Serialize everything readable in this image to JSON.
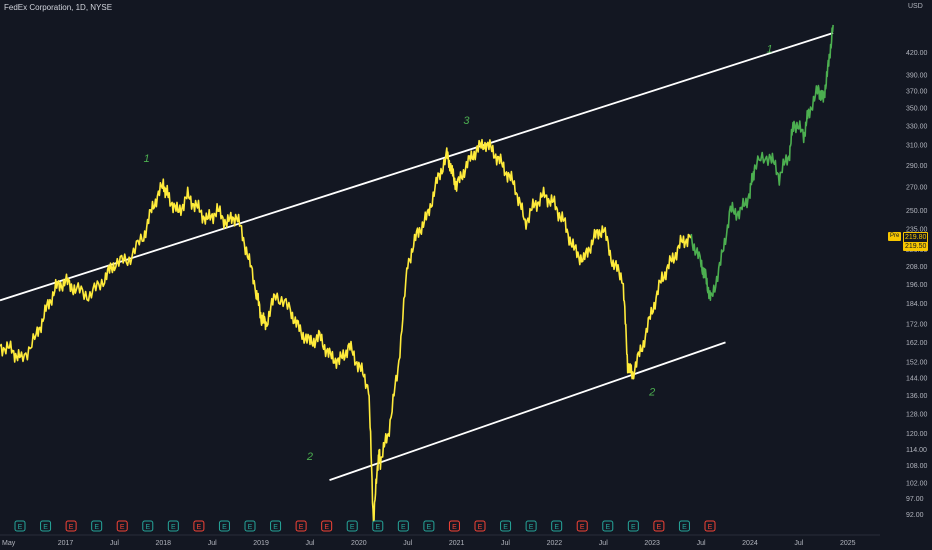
{
  "header": {
    "title": "FedEx Corporation, 1D, NYSE",
    "currency": "USD"
  },
  "price_tags": {
    "pre_label": "Pre",
    "pre_value": "219.80",
    "last_value": "219.50"
  },
  "colors": {
    "background": "#131722",
    "price_line": "#ffeb3b",
    "projection_line": "#4caf50",
    "channel_line": "#ffffff",
    "wave_label": "#4caf50",
    "accent": "#f7c600"
  },
  "chart_data": {
    "type": "line",
    "title": "FedEx Corporation, 1D, NYSE",
    "y_scale": "log",
    "ylim": [
      88,
      480
    ],
    "xlim": [
      2016.33,
      2025.33
    ],
    "grid": false,
    "y_ticks": [
      "92.00",
      "97.00",
      "102.00",
      "108.00",
      "114.00",
      "120.00",
      "128.00",
      "136.00",
      "144.00",
      "152.00",
      "162.00",
      "172.00",
      "184.00",
      "196.00",
      "208.00",
      "220.00",
      "235.00",
      "250.00",
      "270.00",
      "290.00",
      "310.00",
      "330.00",
      "350.00",
      "370.00",
      "390.00",
      "420.00"
    ],
    "x_ticks": [
      {
        "label": "May",
        "x": 2016.33
      },
      {
        "label": "2017",
        "x": 2017.0
      },
      {
        "label": "Jul",
        "x": 2017.5
      },
      {
        "label": "2018",
        "x": 2018.0
      },
      {
        "label": "Jul",
        "x": 2018.5
      },
      {
        "label": "2019",
        "x": 2019.0
      },
      {
        "label": "Jul",
        "x": 2019.5
      },
      {
        "label": "2020",
        "x": 2020.0
      },
      {
        "label": "Jul",
        "x": 2020.5
      },
      {
        "label": "2021",
        "x": 2021.0
      },
      {
        "label": "Jul",
        "x": 2021.5
      },
      {
        "label": "2022",
        "x": 2022.0
      },
      {
        "label": "Jul",
        "x": 2022.5
      },
      {
        "label": "2023",
        "x": 2023.0
      },
      {
        "label": "Jul",
        "x": 2023.5
      },
      {
        "label": "2024",
        "x": 2024.0
      },
      {
        "label": "Jul",
        "x": 2024.5
      },
      {
        "label": "2025",
        "x": 2025.0
      }
    ],
    "series": [
      {
        "role": "price-history",
        "color": "#ffeb3b",
        "x": [
          2016.33,
          2016.45,
          2016.55,
          2016.7,
          2016.8,
          2016.9,
          2017.0,
          2017.1,
          2017.25,
          2017.4,
          2017.5,
          2017.65,
          2017.8,
          2017.9,
          2018.0,
          2018.05,
          2018.15,
          2018.25,
          2018.35,
          2018.45,
          2018.55,
          2018.65,
          2018.75,
          2018.85,
          2018.95,
          2019.0,
          2019.05,
          2019.15,
          2019.3,
          2019.4,
          2019.5,
          2019.6,
          2019.7,
          2019.8,
          2019.9,
          2020.0,
          2020.1,
          2020.15,
          2020.2,
          2020.22,
          2020.3,
          2020.4,
          2020.5,
          2020.6,
          2020.7,
          2020.8,
          2020.9,
          2020.95,
          2021.0,
          2021.1,
          2021.2,
          2021.3,
          2021.4,
          2021.5,
          2021.6,
          2021.7,
          2021.8,
          2021.9,
          2022.0,
          2022.1,
          2022.2,
          2022.3,
          2022.4,
          2022.5,
          2022.6,
          2022.7,
          2022.75,
          2022.8,
          2022.9,
          2023.0,
          2023.1,
          2023.2,
          2023.3,
          2023.4
        ],
        "y": [
          160,
          158,
          153,
          165,
          180,
          194,
          198,
          193,
          189,
          200,
          210,
          213,
          230,
          255,
          272,
          262,
          248,
          262,
          252,
          242,
          250,
          240,
          246,
          220,
          192,
          176,
          172,
          190,
          180,
          168,
          162,
          165,
          155,
          152,
          160,
          150,
          140,
          90,
          112,
          110,
          120,
          148,
          210,
          232,
          245,
          275,
          300,
          285,
          270,
          290,
          305,
          312,
          300,
          285,
          270,
          240,
          255,
          263,
          255,
          240,
          220,
          212,
          228,
          236,
          210,
          200,
          150,
          146,
          160,
          180,
          200,
          212,
          225,
          230
        ]
      },
      {
        "role": "projection",
        "color": "#4caf50",
        "x": [
          2023.4,
          2023.5,
          2023.55,
          2023.6,
          2023.7,
          2023.8,
          2023.9,
          2024.0,
          2024.05,
          2024.2,
          2024.3,
          2024.4,
          2024.45,
          2024.55,
          2024.6,
          2024.7,
          2024.75,
          2024.8,
          2024.85
        ],
        "y": [
          228,
          210,
          200,
          186,
          210,
          250,
          248,
          265,
          290,
          300,
          280,
          300,
          335,
          320,
          345,
          372,
          360,
          400,
          460
        ]
      }
    ],
    "channel_lines": [
      {
        "name": "upper",
        "x": [
          2016.33,
          2024.85
        ],
        "y": [
          186,
          448
        ]
      },
      {
        "name": "lower",
        "x": [
          2019.7,
          2023.75
        ],
        "y": [
          103,
          162
        ]
      }
    ],
    "wave_labels": [
      {
        "text": "1",
        "x": 2017.83,
        "y": 293
      },
      {
        "text": "2",
        "x": 2019.5,
        "y": 110
      },
      {
        "text": "3",
        "x": 2021.1,
        "y": 332
      },
      {
        "text": "2",
        "x": 2023.0,
        "y": 136
      },
      {
        "text": "1",
        "x": 2024.2,
        "y": 420
      }
    ],
    "event_marker_labels": [
      "E",
      "E",
      "E",
      "E",
      "E",
      "E",
      "E",
      "E",
      "E",
      "E",
      "E",
      "E",
      "E",
      "E",
      "E",
      "E",
      "E",
      "E",
      "E",
      "E",
      "E",
      "E",
      "E",
      "E",
      "E",
      "E",
      "E",
      "E"
    ]
  }
}
